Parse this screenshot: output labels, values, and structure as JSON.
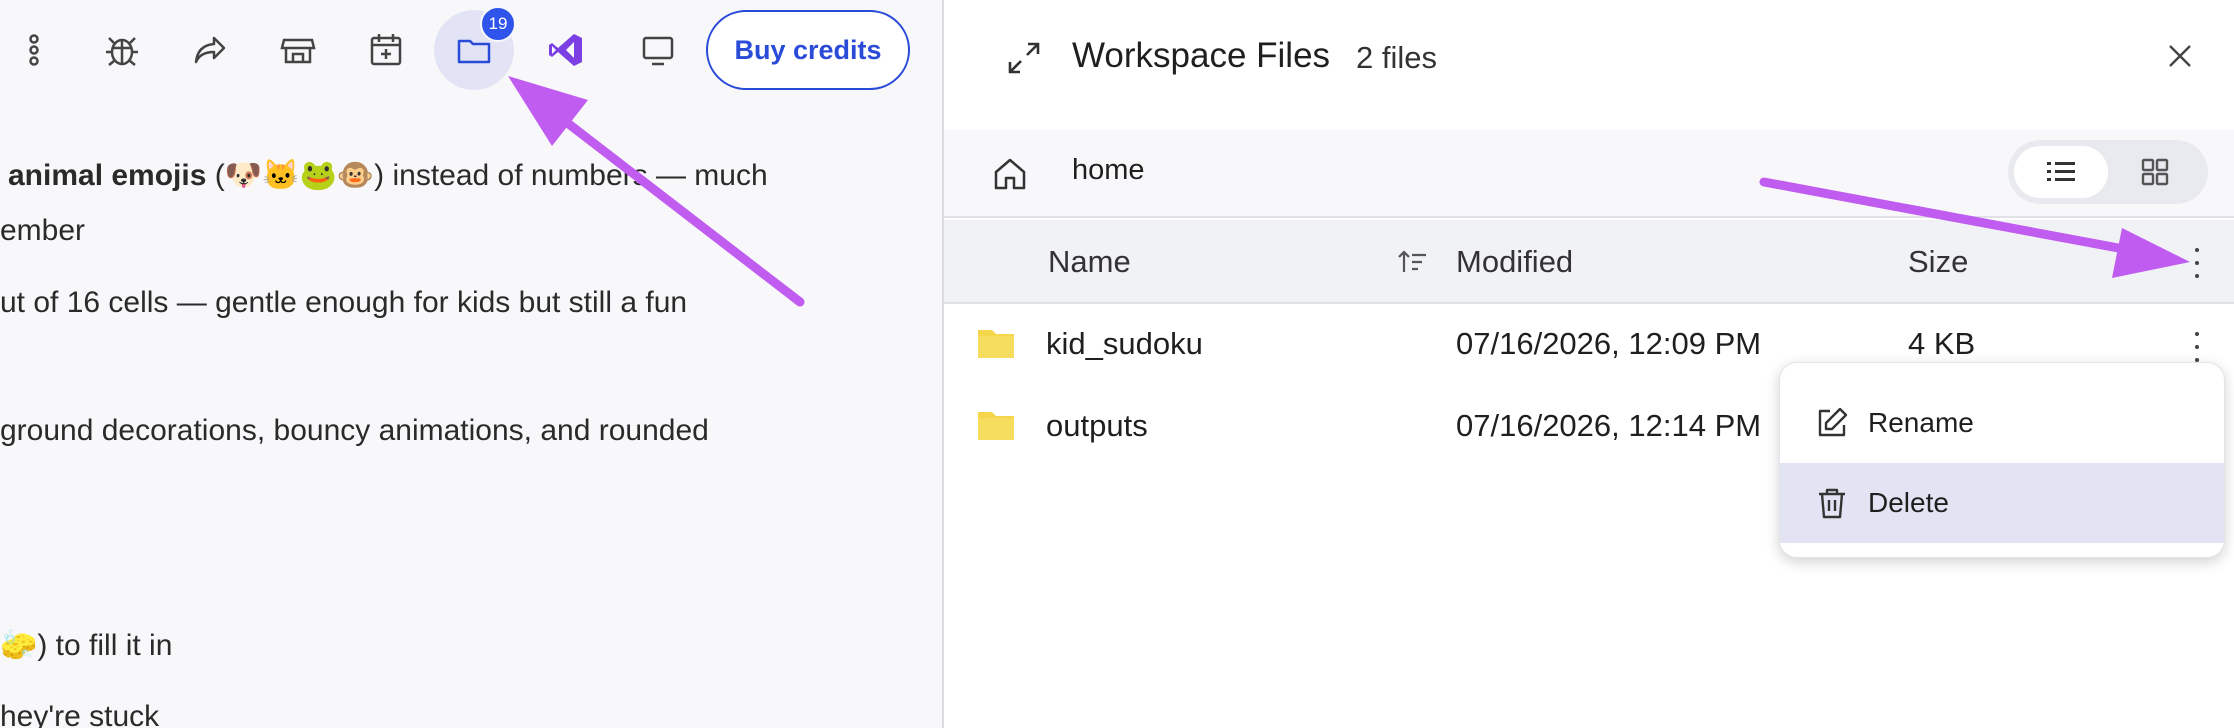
{
  "toolbar": {
    "icons": [
      "more-vert-icon",
      "bug-icon",
      "share-icon",
      "store-icon",
      "calendar-add-icon",
      "folder-icon",
      "visual-studio-icon",
      "monitor-icon"
    ],
    "files_badge": "19",
    "buy_credits_label": "Buy credits"
  },
  "chat": {
    "line1_bold": "animal emojis",
    "line1_rest": " (🐶🐱🐸🐵) instead of numbers — much",
    "line2": "ember",
    "line3": "ut of 16 cells — gentle enough for kids but still a fun",
    "line4": "ground decorations, bouncy animations, and rounded",
    "line5": "🧽) to fill it in",
    "line6": "hey're stuck"
  },
  "files_panel": {
    "title": "Workspace Files",
    "count": "2 files",
    "breadcrumb": "home",
    "columns": {
      "name": "Name",
      "modified": "Modified",
      "size": "Size"
    },
    "rows": [
      {
        "name": "kid_sudoku",
        "modified": "07/16/2026, 12:09 PM",
        "size": "4 KB"
      },
      {
        "name": "outputs",
        "modified": "07/16/2026, 12:14 PM",
        "size": ""
      }
    ],
    "context_menu": {
      "rename": "Rename",
      "delete": "Delete"
    }
  },
  "colors": {
    "accent": "#2a4bd8",
    "arrow": "#c05cf0",
    "folder": "#f5d54a",
    "menu_highlight": "#e3e4f3"
  }
}
